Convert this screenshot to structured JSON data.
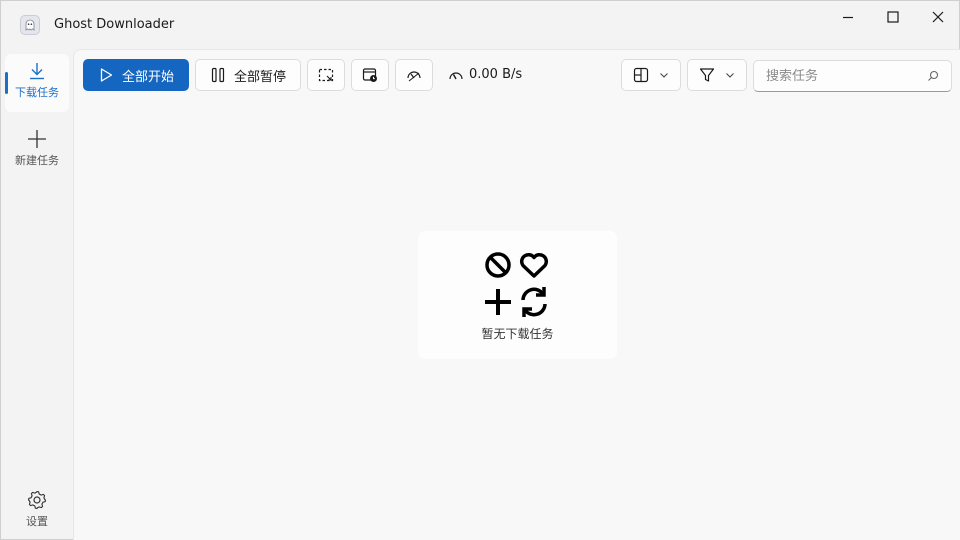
{
  "window": {
    "title": "Ghost Downloader",
    "controls": {
      "minimize_icon": "minimize-icon",
      "maximize_icon": "maximize-icon",
      "close_icon": "close-icon"
    }
  },
  "sidebar": {
    "items": [
      {
        "label": "下载任务",
        "icon": "download-icon",
        "active": true
      },
      {
        "label": "新建任务",
        "icon": "plus-icon",
        "active": false
      }
    ],
    "settings": {
      "label": "设置",
      "icon": "gear-icon"
    }
  },
  "toolbar": {
    "start_all": "全部开始",
    "pause_all": "全部暂停",
    "select_icon": "select-all-icon",
    "schedule_icon": "schedule-icon",
    "limit_icon": "speed-limit-icon",
    "speed": "0.00 B/s",
    "view_icon": "layout-icon",
    "filter_icon": "filter-icon",
    "search_placeholder": "搜索任务"
  },
  "empty_state": {
    "text": "暂无下载任务"
  },
  "colors": {
    "accent": "#1566c0",
    "background": "#f3f3f3",
    "panel": "#f9f8f9"
  }
}
